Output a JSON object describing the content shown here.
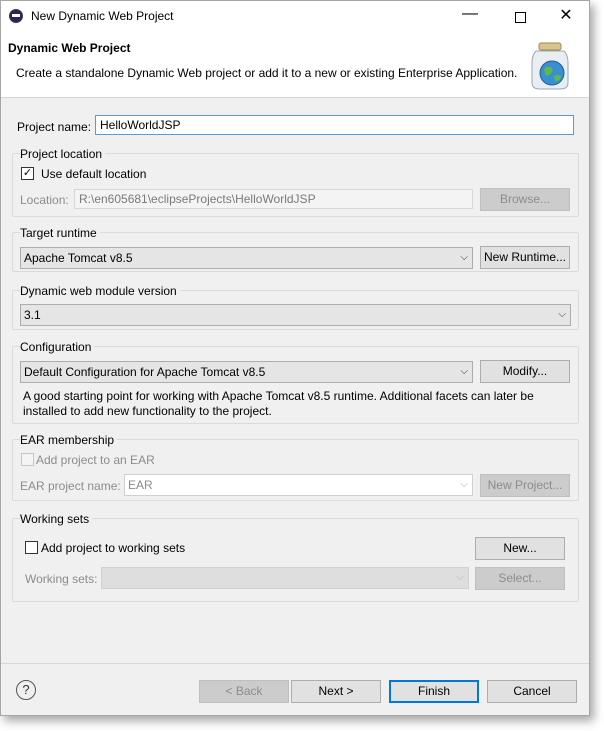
{
  "window": {
    "title": "New Dynamic Web Project",
    "minimize": "—",
    "close": "✕"
  },
  "banner": {
    "title": "Dynamic Web Project",
    "description": "Create a standalone Dynamic Web project or add it to a new or existing Enterprise Application."
  },
  "project_name": {
    "label": "Project name:",
    "value": "HelloWorldJSP"
  },
  "project_location": {
    "group_title": "Project location",
    "use_default_label": "Use default location",
    "use_default_checked": true,
    "location_label": "Location:",
    "location_value": "R:\\en605681\\eclipseProjects\\HelloWorldJSP",
    "browse_label": "Browse..."
  },
  "target_runtime": {
    "group_title": "Target runtime",
    "selected": "Apache Tomcat v8.5",
    "new_runtime_label": "New Runtime..."
  },
  "module_version": {
    "group_title": "Dynamic web module version",
    "selected": "3.1"
  },
  "configuration": {
    "group_title": "Configuration",
    "selected": "Default Configuration for Apache Tomcat v8.5",
    "modify_label": "Modify...",
    "description_line1": "A good starting point for working with Apache Tomcat v8.5 runtime. Additional facets can later be",
    "description_line2": "installed to add new functionality to the project."
  },
  "ear_membership": {
    "group_title": "EAR membership",
    "add_label": "Add project to an EAR",
    "add_checked": false,
    "ear_name_label": "EAR project name:",
    "ear_name_value": "EAR",
    "new_project_label": "New Project..."
  },
  "working_sets": {
    "group_title": "Working sets",
    "add_label": "Add project to working sets",
    "add_checked": false,
    "new_label": "New...",
    "working_sets_label": "Working sets:",
    "working_sets_value": "",
    "select_label": "Select..."
  },
  "footer": {
    "help_icon": "?",
    "back_label": "< Back",
    "next_label": "Next >",
    "finish_label": "Finish",
    "cancel_label": "Cancel"
  },
  "icons": {
    "app": "eclipse-app-icon",
    "banner": "jar-globe-icon",
    "dropdown": "chevron-down-icon",
    "help": "help-icon",
    "checkmark": "✓",
    "arrow": "⌵"
  },
  "colors": {
    "focus_border": "#5b9bd5",
    "default_button_border": "#0078d7",
    "dialog_background": "#f0f0f0"
  }
}
